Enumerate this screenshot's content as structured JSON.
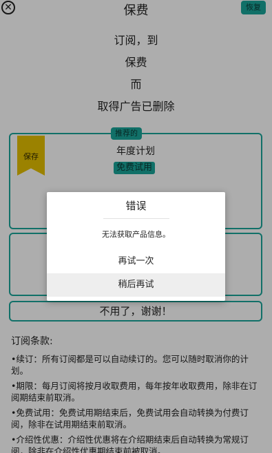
{
  "header": {
    "close_label": "✕",
    "title": "保费",
    "restore_label": "恢复"
  },
  "hero": {
    "line1": "订阅，到",
    "line2": "保费",
    "line3": "而",
    "line4": "取得广告已删除"
  },
  "plans": {
    "recommended_label": "推荐的",
    "ribbon_label": "保存",
    "yearly_name": "年度计划",
    "free_trial_label": "免费试用"
  },
  "no_thanks_label": "不用了，谢谢！",
  "terms": {
    "title": "订阅条款:",
    "items": [
      "•续订：所有订阅都是可以自动续订的。您可以随时取消你的计划。",
      "•期限：每月订阅将按月收取费用，每年按年收取费用，除非在订阅期结束前取消。",
      "•免费试用：免费试用期结束后，免费试用会自动转换为付费订阅，除非在试用期结束前取消。",
      "•介绍性优惠：介绍性优惠将在介绍期结束后自动转换为常规订阅，除非在介绍性优惠期结束前被取消。"
    ]
  },
  "dialog": {
    "title": "错误",
    "message": "无法获取产品信息。",
    "retry_label": "再试一次",
    "later_label": "稍后再试"
  },
  "colors": {
    "accent": "#1aa59a",
    "ribbon": "#e5c000",
    "overlay": "rgba(0,0,0,0.32)"
  }
}
